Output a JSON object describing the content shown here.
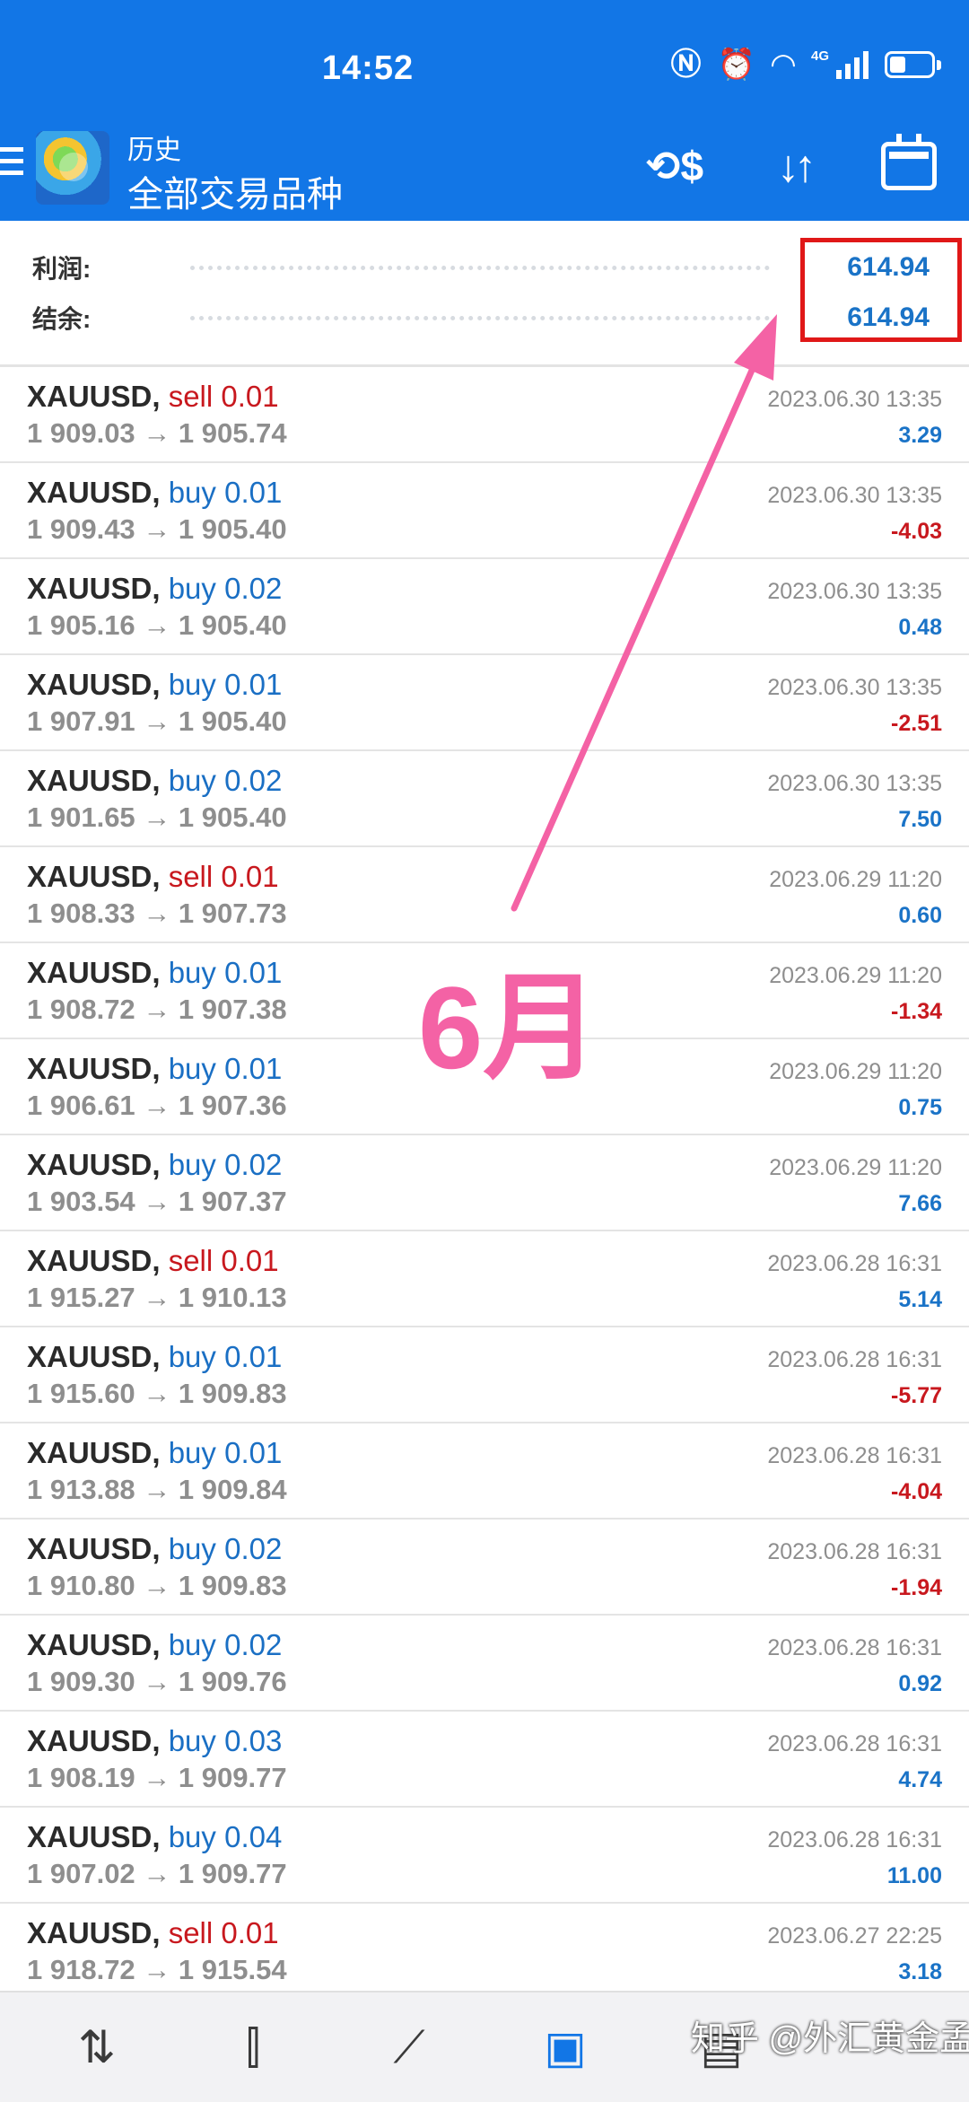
{
  "status_bar": {
    "time": "14:52",
    "network": "4G"
  },
  "app_bar": {
    "subtitle": "历史",
    "title": "全部交易品种"
  },
  "icons": {
    "currency": "currency-exchange-icon",
    "sort": "sort-icon",
    "calendar": "calendar-icon"
  },
  "summary": {
    "profit_label": "利润:",
    "profit_value": "614.94",
    "balance_label": "结余:",
    "balance_value": "614.94"
  },
  "annotation": {
    "text": "6月"
  },
  "trades": [
    {
      "symbol": "XAUUSD,",
      "side": "sell",
      "volume": "0.01",
      "open": "1 909.03",
      "close": "1 905.74",
      "time": "2023.06.30 13:35",
      "profit": "3.29"
    },
    {
      "symbol": "XAUUSD,",
      "side": "buy",
      "volume": "0.01",
      "open": "1 909.43",
      "close": "1 905.40",
      "time": "2023.06.30 13:35",
      "profit": "-4.03"
    },
    {
      "symbol": "XAUUSD,",
      "side": "buy",
      "volume": "0.02",
      "open": "1 905.16",
      "close": "1 905.40",
      "time": "2023.06.30 13:35",
      "profit": "0.48"
    },
    {
      "symbol": "XAUUSD,",
      "side": "buy",
      "volume": "0.01",
      "open": "1 907.91",
      "close": "1 905.40",
      "time": "2023.06.30 13:35",
      "profit": "-2.51"
    },
    {
      "symbol": "XAUUSD,",
      "side": "buy",
      "volume": "0.02",
      "open": "1 901.65",
      "close": "1 905.40",
      "time": "2023.06.30 13:35",
      "profit": "7.50"
    },
    {
      "symbol": "XAUUSD,",
      "side": "sell",
      "volume": "0.01",
      "open": "1 908.33",
      "close": "1 907.73",
      "time": "2023.06.29 11:20",
      "profit": "0.60"
    },
    {
      "symbol": "XAUUSD,",
      "side": "buy",
      "volume": "0.01",
      "open": "1 908.72",
      "close": "1 907.38",
      "time": "2023.06.29 11:20",
      "profit": "-1.34"
    },
    {
      "symbol": "XAUUSD,",
      "side": "buy",
      "volume": "0.01",
      "open": "1 906.61",
      "close": "1 907.36",
      "time": "2023.06.29 11:20",
      "profit": "0.75"
    },
    {
      "symbol": "XAUUSD,",
      "side": "buy",
      "volume": "0.02",
      "open": "1 903.54",
      "close": "1 907.37",
      "time": "2023.06.29 11:20",
      "profit": "7.66"
    },
    {
      "symbol": "XAUUSD,",
      "side": "sell",
      "volume": "0.01",
      "open": "1 915.27",
      "close": "1 910.13",
      "time": "2023.06.28 16:31",
      "profit": "5.14"
    },
    {
      "symbol": "XAUUSD,",
      "side": "buy",
      "volume": "0.01",
      "open": "1 915.60",
      "close": "1 909.83",
      "time": "2023.06.28 16:31",
      "profit": "-5.77"
    },
    {
      "symbol": "XAUUSD,",
      "side": "buy",
      "volume": "0.01",
      "open": "1 913.88",
      "close": "1 909.84",
      "time": "2023.06.28 16:31",
      "profit": "-4.04"
    },
    {
      "symbol": "XAUUSD,",
      "side": "buy",
      "volume": "0.02",
      "open": "1 910.80",
      "close": "1 909.83",
      "time": "2023.06.28 16:31",
      "profit": "-1.94"
    },
    {
      "symbol": "XAUUSD,",
      "side": "buy",
      "volume": "0.02",
      "open": "1 909.30",
      "close": "1 909.76",
      "time": "2023.06.28 16:31",
      "profit": "0.92"
    },
    {
      "symbol": "XAUUSD,",
      "side": "buy",
      "volume": "0.03",
      "open": "1 908.19",
      "close": "1 909.77",
      "time": "2023.06.28 16:31",
      "profit": "4.74"
    },
    {
      "symbol": "XAUUSD,",
      "side": "buy",
      "volume": "0.04",
      "open": "1 907.02",
      "close": "1 909.77",
      "time": "2023.06.28 16:31",
      "profit": "11.00"
    },
    {
      "symbol": "XAUUSD,",
      "side": "sell",
      "volume": "0.01",
      "open": "1 918.72",
      "close": "1 915.54",
      "time": "2023.06.27 22:25",
      "profit": "3.18"
    }
  ],
  "bottom_nav": [
    {
      "name": "quotes",
      "icon": "quotes-arrows-icon"
    },
    {
      "name": "chart",
      "icon": "candlestick-icon"
    },
    {
      "name": "trade",
      "icon": "trade-line-icon"
    },
    {
      "name": "history",
      "icon": "inbox-icon",
      "active": true
    },
    {
      "name": "messages",
      "icon": "messages-icon"
    }
  ],
  "watermark": "知乎 @外汇黄金孟丹",
  "colors": {
    "header": "#1276e6",
    "sell": "#c8181e",
    "buy": "#1a6fc4",
    "profit_positive": "#1a73c7",
    "profit_negative": "#c8181e",
    "annotation": "#f462a5",
    "highlight_box": "#e01818"
  }
}
